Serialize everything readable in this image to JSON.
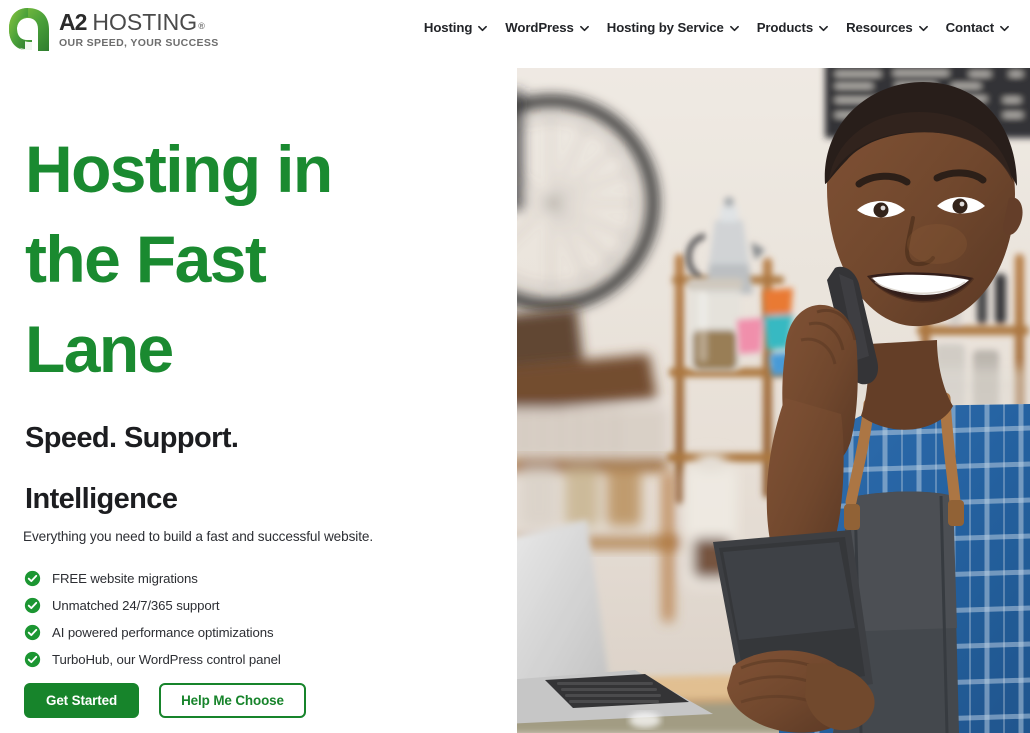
{
  "brand": {
    "logo_icon": "a2-logo-mark",
    "name_a2": "A2",
    "name_hosting": "HOSTING",
    "registered": "®",
    "tagline": "OUR SPEED, YOUR SUCCESS",
    "green": "#17842b",
    "heading_green": "#1a8a30"
  },
  "nav": {
    "items": [
      {
        "label": "Hosting",
        "icon": "chevron-down-icon"
      },
      {
        "label": "WordPress",
        "icon": "chevron-down-icon"
      },
      {
        "label": "Hosting by Service",
        "icon": "chevron-down-icon"
      },
      {
        "label": "Products",
        "icon": "chevron-down-icon"
      },
      {
        "label": "Resources",
        "icon": "chevron-down-icon"
      },
      {
        "label": "Contact",
        "icon": "chevron-down-icon"
      }
    ]
  },
  "hero": {
    "heading_line1": "Hosting in",
    "heading_line2": "the Fast",
    "heading_line3": "Lane",
    "subheading_line1": "Speed. Support.",
    "subheading_line2": "Intelligence",
    "lede": "Everything you need to build a fast and successful website.",
    "features": [
      {
        "icon": "check-circle-icon",
        "label": "FREE website migrations"
      },
      {
        "icon": "check-circle-icon",
        "label": "Unmatched 24/7/365 support"
      },
      {
        "icon": "check-circle-icon",
        "label": "AI powered performance optimizations"
      },
      {
        "icon": "check-circle-icon",
        "label": "TurboHub, our WordPress control panel"
      }
    ],
    "primary_cta": "Get Started",
    "secondary_cta": "Help Me Choose",
    "image_alt": "smiling-man-on-phone-in-cafe"
  }
}
